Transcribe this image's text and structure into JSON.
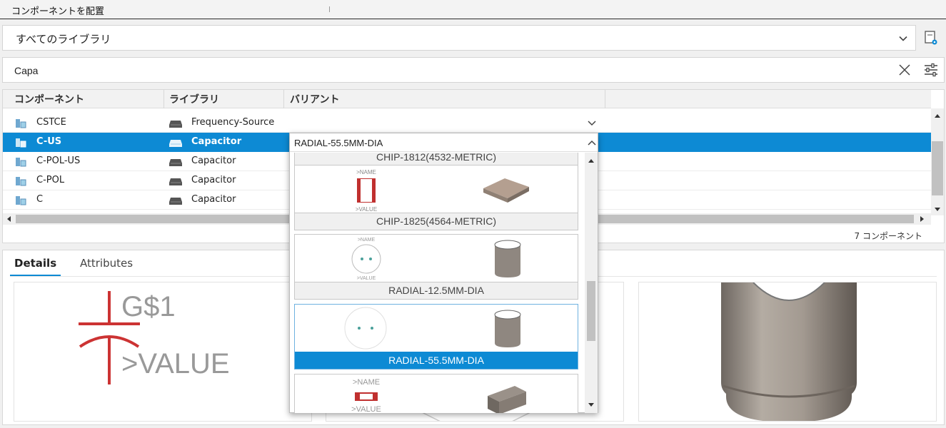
{
  "window": {
    "title": "コンポーネントを配置"
  },
  "library_select": {
    "value": "すべてのライブラリ"
  },
  "search": {
    "value": "Capa"
  },
  "table": {
    "columns": [
      "コンポーネント",
      "ライブラリ",
      "バリアント"
    ],
    "rows": [
      {
        "component": "CSTCE",
        "library": "Frequency-Source"
      },
      {
        "component": "C-US",
        "library": "Capacitor",
        "variant": "RADIAL-55.5MM-DIA"
      },
      {
        "component": "C-POL-US",
        "library": "Capacitor"
      },
      {
        "component": "C-POL",
        "library": "Capacitor"
      },
      {
        "component": "C",
        "library": "Capacitor"
      }
    ],
    "count_label": "7 コンポーネント"
  },
  "tabs": {
    "details": "Details",
    "attributes": "Attributes"
  },
  "symbol": {
    "name": "G$1",
    "value": ">VALUE"
  },
  "variant_dropdown": {
    "selected": "RADIAL-55.5MM-DIA",
    "items": [
      {
        "label": "CHIP-1812(4532-METRIC)",
        "name_tag": ">NAME",
        "value_tag": ">VALUE"
      },
      {
        "label": "CHIP-1825(4564-METRIC)",
        "name_tag": ">NAME",
        "value_tag": ">VALUE"
      },
      {
        "label": "RADIAL-12.5MM-DIA",
        "name_tag": ">NAME",
        "value_tag": ">VALUE"
      },
      {
        "label": "RADIAL-55.5MM-DIA"
      },
      {
        "label": "",
        "name_tag": ">NAME",
        "value_tag": ">VALUE"
      }
    ]
  },
  "colors": {
    "accent": "#0d8ad4",
    "symbol_red": "#cc3333"
  },
  "icons": [
    "chevron-down-icon",
    "library-settings-icon",
    "clear-icon",
    "filter-icon",
    "component-icon",
    "library-drive-icon",
    "chevron-up-icon"
  ]
}
